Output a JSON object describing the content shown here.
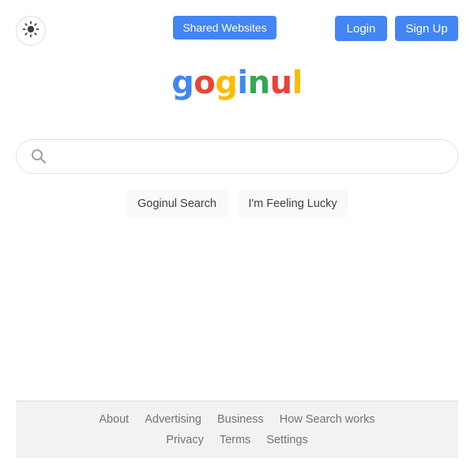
{
  "header": {
    "shared_websites_label": "Shared Websites",
    "login_label": "Login",
    "signup_label": "Sign Up",
    "theme_icon": "sun-icon"
  },
  "logo": {
    "letters": [
      {
        "char": "g",
        "color": "#4285f4"
      },
      {
        "char": "o",
        "color": "#ea4335"
      },
      {
        "char": "g",
        "color": "#fbbc05"
      },
      {
        "char": "i",
        "color": "#4285f4"
      },
      {
        "char": "n",
        "color": "#34a853"
      },
      {
        "char": "u",
        "color": "#ea4335"
      },
      {
        "char": "l",
        "color": "#fbbc05"
      }
    ]
  },
  "search": {
    "value": "",
    "placeholder": "",
    "icon": "search-icon",
    "search_button_label": "Goginul Search",
    "lucky_button_label": "I'm Feeling Lucky"
  },
  "footer": {
    "row1": [
      "About",
      "Advertising",
      "Business",
      "How Search works"
    ],
    "row2": [
      "Privacy",
      "Terms",
      "Settings"
    ]
  },
  "colors": {
    "accent": "#4285f4",
    "footer_bg": "#f2f2f2",
    "footer_text": "#70757a"
  }
}
